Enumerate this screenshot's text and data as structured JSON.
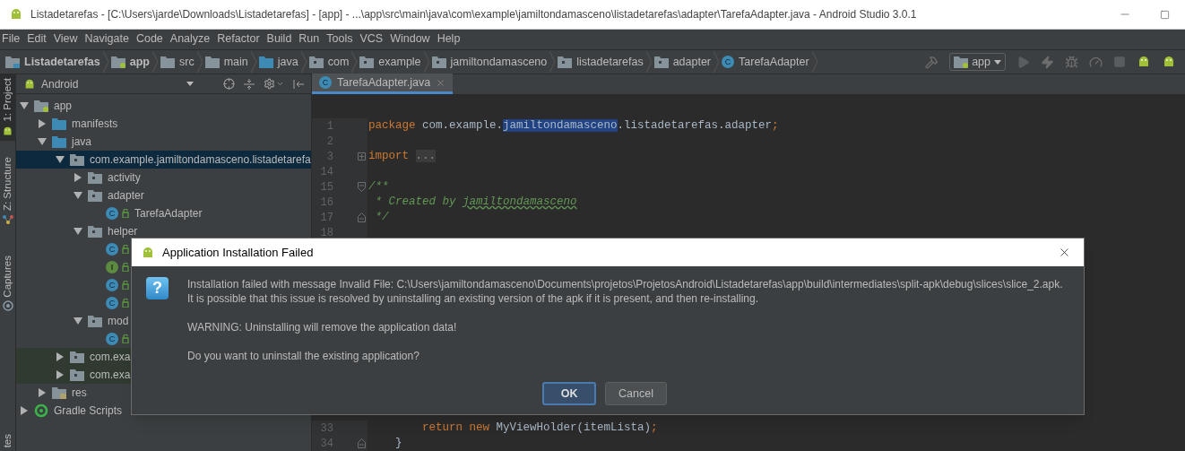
{
  "window": {
    "title": "Listadetarefas - [C:\\Users\\jarde\\Downloads\\Listadetarefas] - [app] - ...\\app\\src\\main\\java\\com\\example\\jamiltondamasceno\\listadetarefas\\adapter\\TarefaAdapter.java - Android Studio 3.0.1"
  },
  "menu": [
    "File",
    "Edit",
    "View",
    "Navigate",
    "Code",
    "Analyze",
    "Refactor",
    "Build",
    "Run",
    "Tools",
    "VCS",
    "Window",
    "Help"
  ],
  "breadcrumbs": [
    {
      "label": "Listadetarefas",
      "kind": "project"
    },
    {
      "label": "app",
      "kind": "module"
    },
    {
      "label": "src",
      "kind": "folder"
    },
    {
      "label": "main",
      "kind": "folder"
    },
    {
      "label": "java",
      "kind": "source"
    },
    {
      "label": "com",
      "kind": "package"
    },
    {
      "label": "example",
      "kind": "package"
    },
    {
      "label": "jamiltondamasceno",
      "kind": "package"
    },
    {
      "label": "listadetarefas",
      "kind": "package"
    },
    {
      "label": "adapter",
      "kind": "package"
    },
    {
      "label": "TarefaAdapter",
      "kind": "class",
      "icon_letter": "C"
    }
  ],
  "run_config": "app",
  "side_tabs": [
    {
      "label": "1: Project",
      "selected": true,
      "kind": "project"
    },
    {
      "label": "Z: Structure",
      "selected": false,
      "kind": "structure"
    },
    {
      "label": "Captures",
      "selected": false,
      "kind": "captures"
    },
    {
      "label": "tes",
      "selected": false,
      "kind": "plain"
    }
  ],
  "project_panel": {
    "view": "Android",
    "tree": [
      {
        "label": "app",
        "kind": "module",
        "expanded": true,
        "selected": false,
        "highlighted": false,
        "children": [
          {
            "label": "manifests",
            "kind": "source",
            "expanded": false,
            "selected": false,
            "highlighted": false
          },
          {
            "label": "java",
            "kind": "source",
            "expanded": true,
            "selected": false,
            "highlighted": false,
            "children": [
              {
                "label": "com.example.jamiltondamasceno.listadetarefa",
                "kind": "package",
                "expanded": true,
                "selected": true,
                "highlighted": false,
                "children": [
                  {
                    "label": "activity",
                    "kind": "package",
                    "expanded": false,
                    "selected": false,
                    "highlighted": false
                  },
                  {
                    "label": "adapter",
                    "kind": "package",
                    "expanded": true,
                    "selected": false,
                    "highlighted": false,
                    "children": [
                      {
                        "label": "TarefaAdapter",
                        "kind": "class",
                        "icon_letter": "C",
                        "selected": false,
                        "highlighted": false
                      }
                    ]
                  },
                  {
                    "label": "helper",
                    "kind": "package",
                    "expanded": true,
                    "selected": false,
                    "highlighted": false,
                    "children": [
                      {
                        "kind": "class",
                        "icon_letter": "C",
                        "selected": false,
                        "highlighted": false
                      },
                      {
                        "kind": "interface",
                        "icon_letter": "I",
                        "selected": false,
                        "highlighted": false
                      },
                      {
                        "kind": "class",
                        "icon_letter": "C",
                        "selected": false,
                        "highlighted": false
                      },
                      {
                        "kind": "class",
                        "icon_letter": "C",
                        "selected": false,
                        "highlighted": false
                      }
                    ]
                  },
                  {
                    "label": "mod",
                    "kind": "package",
                    "expanded": true,
                    "selected": false,
                    "highlighted": false,
                    "children": [
                      {
                        "kind": "class",
                        "icon_letter": "C",
                        "selected": false,
                        "highlighted": false
                      }
                    ]
                  }
                ]
              },
              {
                "label": "com.exa",
                "kind": "package",
                "expanded": false,
                "selected": false,
                "highlighted": true
              },
              {
                "label": "com.exa",
                "kind": "package",
                "expanded": false,
                "selected": false,
                "highlighted": true
              }
            ]
          },
          {
            "label": "res",
            "kind": "res",
            "expanded": false,
            "selected": false,
            "highlighted": false
          }
        ]
      },
      {
        "label": "Gradle Scripts",
        "kind": "gradle",
        "expanded": false,
        "selected": false,
        "highlighted": false
      }
    ]
  },
  "editor": {
    "tabs": [
      {
        "label": "TarefaAdapter.java",
        "icon_letter": "C",
        "selected": true
      }
    ],
    "blocks": [
      {
        "lines": [
          {
            "number": "1",
            "tokens": [
              {
                "text": "package",
                "kind": "keyword"
              },
              {
                "text": " com.example.",
                "kind": "plain"
              },
              {
                "text": "jamiltondamasceno",
                "kind": "selected"
              },
              {
                "text": ".listadetarefas.adapter",
                "kind": "plain"
              },
              {
                "text": ";",
                "kind": "keyword"
              }
            ]
          },
          {
            "number": "2"
          },
          {
            "number": "3",
            "fold_marker": {
              "kind": "expand"
            },
            "tokens": [
              {
                "text": "import ",
                "kind": "keyword"
              },
              {
                "text": "...",
                "kind": "folded"
              }
            ]
          },
          {
            "number": "14"
          },
          {
            "number": "15",
            "fold_marker": {
              "kind": "collapse"
            },
            "tokens": [
              {
                "text": "/**",
                "kind": "doc"
              }
            ]
          },
          {
            "number": "16",
            "tokens": [
              {
                "text": " * Created by ",
                "kind": "doc"
              },
              {
                "text": "jamiltondamasceno",
                "kind": "doc-underlined"
              }
            ]
          },
          {
            "number": "17",
            "fold_marker": {
              "kind": "end"
            },
            "tokens": [
              {
                "text": " */",
                "kind": "doc"
              }
            ]
          },
          {
            "number": "18"
          }
        ]
      },
      {
        "lines": [
          {
            "number": "33",
            "tokens": [
              {
                "text": "        return new",
                "kind": "keyword"
              },
              {
                "text": " MyViewHolder(itemLista)",
                "kind": "plain"
              },
              {
                "text": ";",
                "kind": "keyword"
              }
            ]
          },
          {
            "number": "34",
            "fold_marker": {
              "kind": "end"
            },
            "tokens": [
              {
                "text": "    }",
                "kind": "plain"
              }
            ]
          }
        ]
      }
    ]
  },
  "dialog": {
    "title": "Application Installation Failed",
    "icon_glyph": "?",
    "paragraphs": [
      "Installation failed with message Invalid File: C:\\Users\\jamiltondamasceno\\Documents\\projetos\\ProjetosAndroid\\Listadetarefas\\app\\build\\intermediates\\split-apk\\debug\\slices\\slice_2.apk.\nIt is possible that this issue is resolved by uninstalling an existing version of the apk if it is present, and then re-installing.",
      "WARNING: Uninstalling will remove the application data!",
      "Do you want to uninstall the existing application?"
    ],
    "buttons": [
      {
        "label": "OK",
        "default": true
      },
      {
        "label": "Cancel",
        "default": false
      }
    ]
  }
}
